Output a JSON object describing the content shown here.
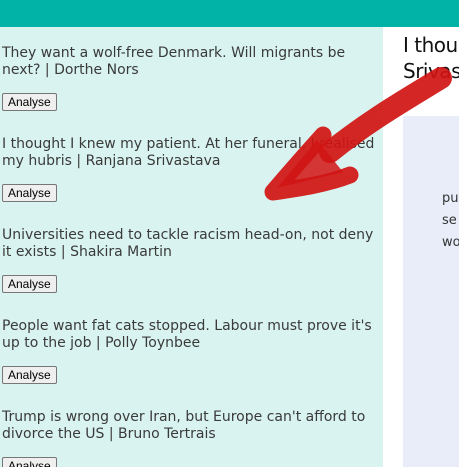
{
  "articles": [
    {
      "title": "They want a wolf-free Denmark. Will migrants be next? | Dorthe Nors",
      "button": "Analyse"
    },
    {
      "title": "I thought I knew my patient. At her funeral, I realised my hubris | Ranjana Srivastava",
      "button": "Analyse"
    },
    {
      "title": "Universities need to tackle racism head-on, not deny it exists | Shakira Martin",
      "button": "Analyse"
    },
    {
      "title": "People want fat cats stopped. Labour must prove it's up to the job | Polly Toynbee",
      "button": "Analyse"
    },
    {
      "title": "Trump is wrong over Iran, but Europe can't afford to divorce the US | Bruno Tertrais",
      "button": "Analyse"
    }
  ],
  "detail": {
    "heading_line1": "I thou",
    "heading_line2": "Srivas",
    "body_lines": [
      "pu",
      "se",
      "wo"
    ]
  },
  "colors": {
    "header": "#00b3a6",
    "list_bg": "#d9f4f0",
    "detail_bg": "#e8edf9",
    "annotation": "#d11414"
  }
}
